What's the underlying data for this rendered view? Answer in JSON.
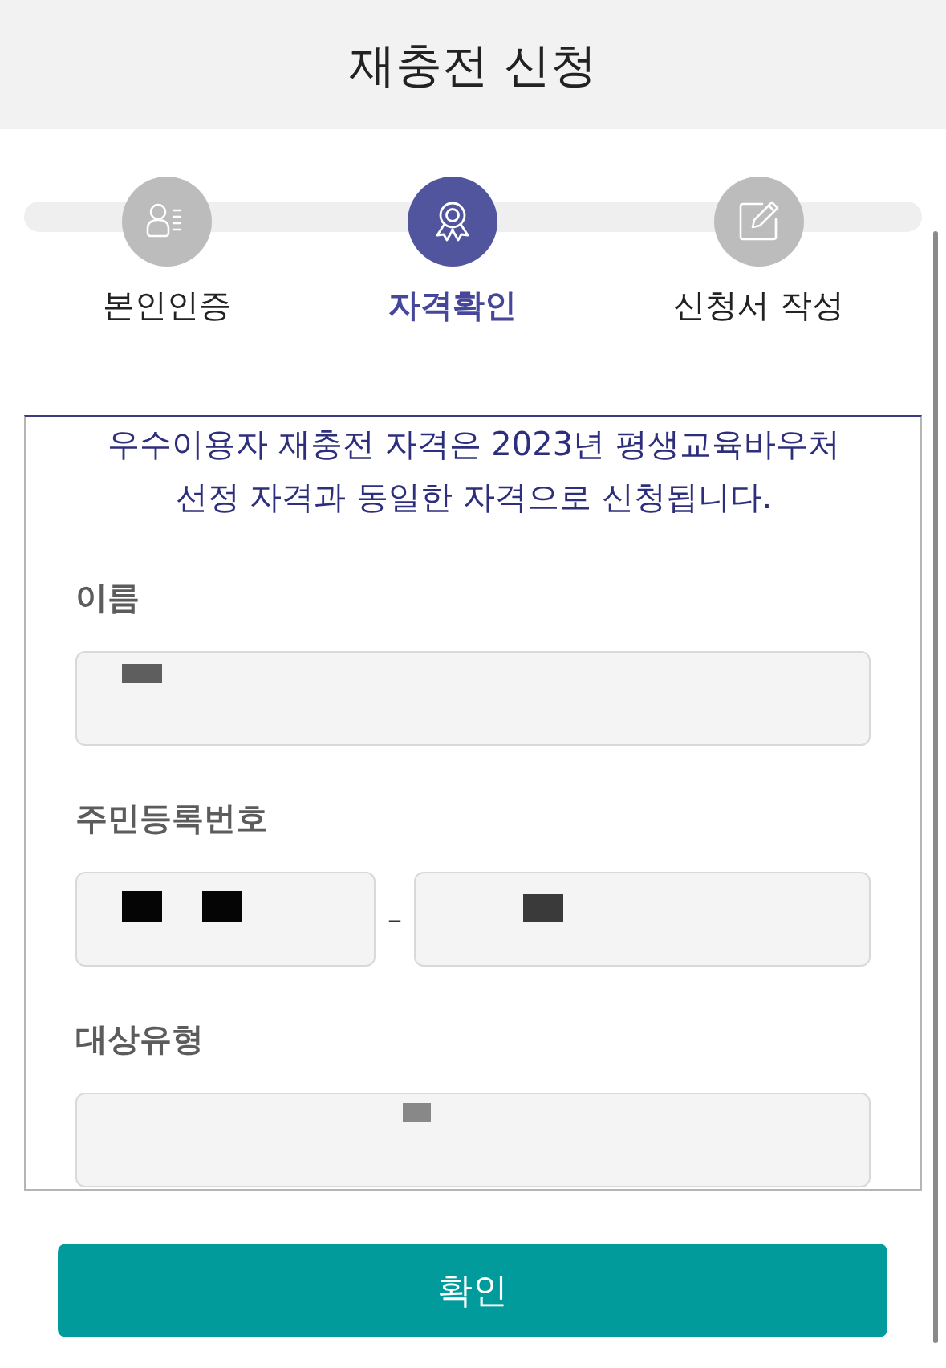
{
  "header": {
    "title": "재충전 신청"
  },
  "steps": [
    {
      "label": "본인인증",
      "kind": "identity",
      "selected": false
    },
    {
      "label": "자격확인",
      "kind": "qualification",
      "selected": true
    },
    {
      "label": "신청서 작성",
      "kind": "form",
      "selected": false
    }
  ],
  "notice": "우수이용자 재충전 자격은 2023년 평생교육바우처 선정 자격과 동일한 자격으로 신청됩니다.",
  "fields": [
    {
      "label": "이름",
      "kind": "single"
    },
    {
      "label": "주민등록번호",
      "kind": "split",
      "separator": "–"
    },
    {
      "label": "대상유형",
      "kind": "single"
    }
  ],
  "confirm_button": {
    "label": "확인"
  }
}
